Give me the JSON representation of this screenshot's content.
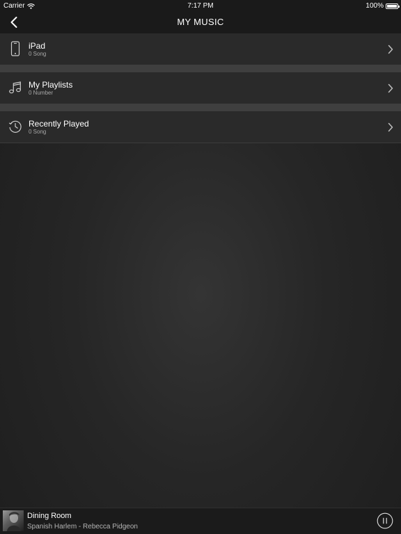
{
  "status_bar": {
    "carrier": "Carrier",
    "time": "7:17 PM",
    "battery": "100%",
    "battery_level": 1.0
  },
  "nav": {
    "title": "MY MUSIC",
    "back_icon": "chevron-left-icon"
  },
  "list": {
    "items": [
      {
        "title": "iPad",
        "subtitle": "0 Song",
        "icon": "tablet-icon"
      },
      {
        "title": "My Playlists",
        "subtitle": "0 Number",
        "icon": "music-note-icon"
      },
      {
        "title": "Recently Played",
        "subtitle": "0 Song",
        "icon": "clock-icon"
      }
    ]
  },
  "now_playing": {
    "room": "Dining Room",
    "track": "Spanish Harlem - Rebecca Pidgeon",
    "control_icon": "pause-icon"
  },
  "colors": {
    "background": "#262626",
    "row": "#2a2a2a",
    "separator": "#3f3f3f",
    "bar": "#1a1a1a",
    "subtitle": "#a8a8a8"
  }
}
